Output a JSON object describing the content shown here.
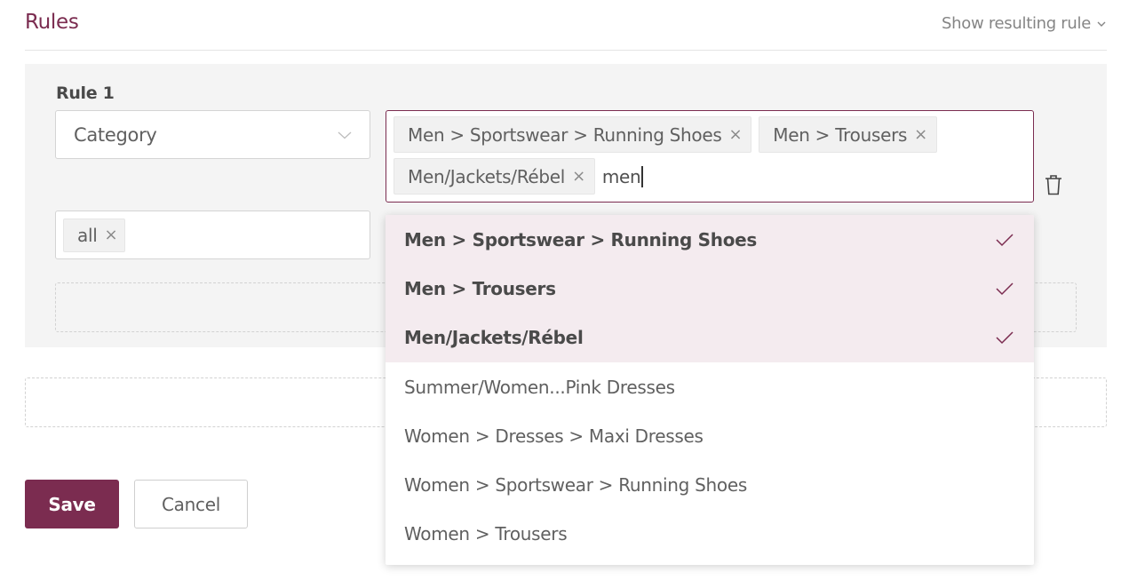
{
  "header": {
    "title": "Rules",
    "show_rule_label": "Show resulting rule"
  },
  "rule": {
    "label": "Rule 1",
    "attribute": "Category",
    "selected_tags": [
      {
        "label": "Men > Sportswear > Running Shoes"
      },
      {
        "label": "Men > Trousers"
      },
      {
        "label": "Men/Jackets/Rébel"
      }
    ],
    "search_text": "men",
    "value_tags": [
      {
        "label": "all"
      }
    ]
  },
  "dropdown": {
    "options": [
      {
        "label": "Men > Sportswear > Running Shoes",
        "selected": true
      },
      {
        "label": "Men > Trousers",
        "selected": true
      },
      {
        "label": "Men/Jackets/Rébel",
        "selected": true
      },
      {
        "label": "Summer/Women...Pink Dresses",
        "selected": false
      },
      {
        "label": "Women > Dresses > Maxi Dresses",
        "selected": false
      },
      {
        "label": "Women > Sportswear > Running Shoes",
        "selected": false
      },
      {
        "label": "Women > Trousers",
        "selected": false
      }
    ]
  },
  "actions": {
    "save_label": "Save",
    "cancel_label": "Cancel"
  },
  "colors": {
    "accent": "#7b2c50",
    "selected_bg": "#f4ebef",
    "panel_bg": "#f4f4f4"
  }
}
